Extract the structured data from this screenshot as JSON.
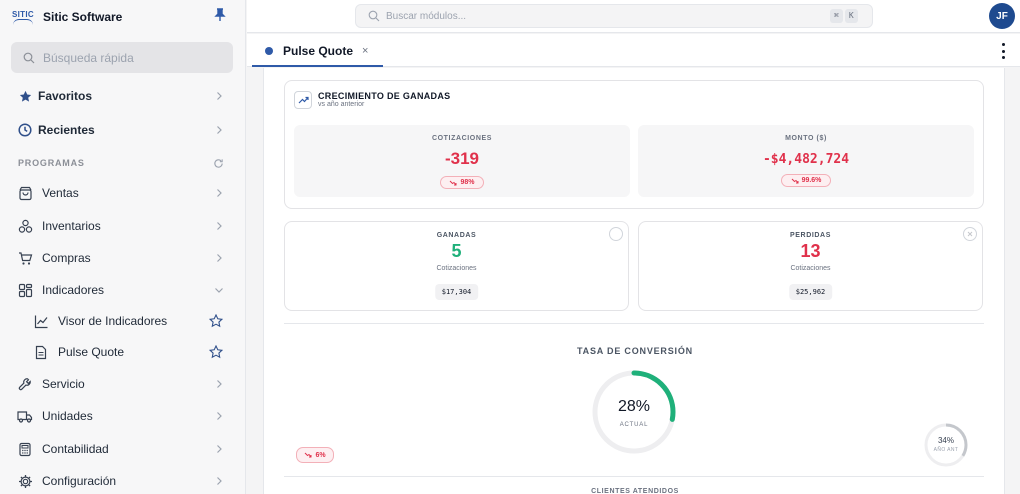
{
  "brand": {
    "logo_text": "SITIC",
    "name": "Sitic Software",
    "accent": "#2f5aa8"
  },
  "sidebar": {
    "quick_search_placeholder": "Búsqueda rápida",
    "favorites": "Favoritos",
    "recent": "Recientes",
    "programs_label": "PROGRAMAS",
    "items": [
      {
        "label": "Ventas",
        "icon": "shopping-bag-icon"
      },
      {
        "label": "Inventarios",
        "icon": "boxes-icon"
      },
      {
        "label": "Compras",
        "icon": "cart-icon"
      },
      {
        "label": "Indicadores",
        "icon": "dashboard-icon",
        "expanded": true
      },
      {
        "label": "Visor de Indicadores",
        "icon": "chart-line-icon",
        "sub": true
      },
      {
        "label": "Pulse Quote",
        "icon": "document-icon",
        "sub": true
      },
      {
        "label": "Servicio",
        "icon": "wrench-icon"
      },
      {
        "label": "Unidades",
        "icon": "truck-icon"
      },
      {
        "label": "Contabilidad",
        "icon": "calculator-icon"
      },
      {
        "label": "Configuración",
        "icon": "gear-icon"
      }
    ]
  },
  "topbar": {
    "search_placeholder": "Buscar módulos...",
    "shortcut": [
      "⌘",
      "K"
    ],
    "avatar_initials": "JF"
  },
  "tabs": [
    {
      "label": "Pulse Quote",
      "close": "×",
      "active": true
    }
  ],
  "growth": {
    "title": "CRECIMIENTO DE GANADAS",
    "subtitle": "vs año anterior",
    "cotizaciones": {
      "label": "COTIZACIONES",
      "value": "-319",
      "change": "98%"
    },
    "monto": {
      "label": "MONTO ($)",
      "value": "-$4,482,724",
      "change": "99.6%"
    }
  },
  "ganadas": {
    "label": "GANADAS",
    "value": "5",
    "sub": "Cotizaciones",
    "amount": "$17,304",
    "color": "#1fb07a"
  },
  "perdidas": {
    "label": "PERDIDAS",
    "value": "13",
    "sub": "Cotizaciones",
    "amount": "$25,962",
    "color": "#e0314b"
  },
  "conversion": {
    "title": "TASA DE CONVERSIÓN",
    "value": "28%",
    "value_fraction": 0.28,
    "sub": "ACTUAL",
    "change": "6%",
    "previous": "34%",
    "previous_fraction": 0.34,
    "previous_sub": "AÑO ANT",
    "color": "#1fb07a"
  },
  "next_section": "CLIENTES ATENDIDOS"
}
